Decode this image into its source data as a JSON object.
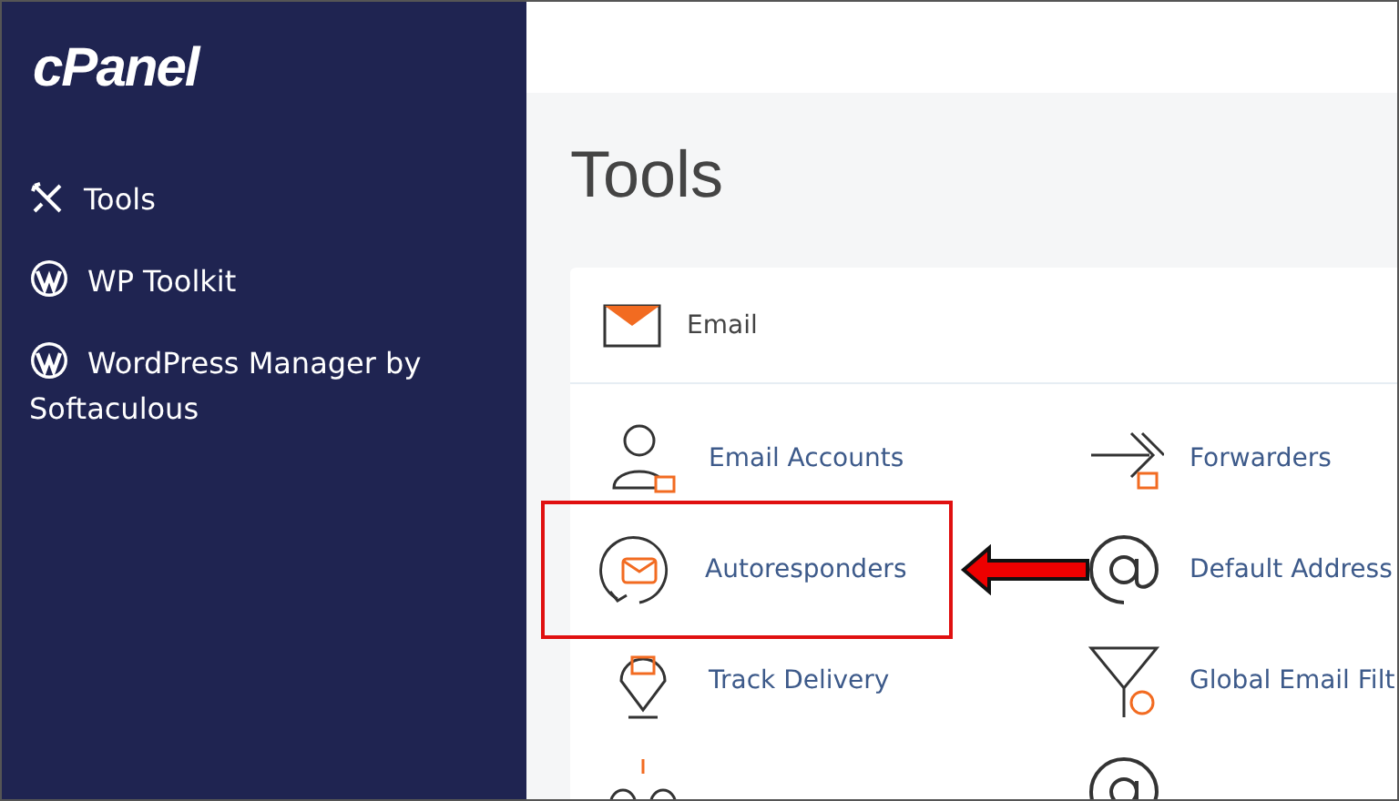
{
  "sidebar": {
    "logo": "cPanel",
    "items": [
      {
        "label": "Tools",
        "kind": "tools"
      },
      {
        "label": "WP Toolkit",
        "kind": "wordpress"
      },
      {
        "label": "WordPress Manager by Softaculous",
        "kind": "wordpress"
      }
    ]
  },
  "page": {
    "title": "Tools"
  },
  "section": {
    "title": "Email",
    "items": [
      {
        "label": "Email Accounts",
        "highlighted": false
      },
      {
        "label": "Forwarders",
        "highlighted": false
      },
      {
        "label": "Autoresponders",
        "highlighted": true
      },
      {
        "label": "Default Address",
        "highlighted": false
      },
      {
        "label": "Track Delivery",
        "highlighted": false
      },
      {
        "label": "Global Email Filt",
        "highlighted": false
      }
    ]
  }
}
